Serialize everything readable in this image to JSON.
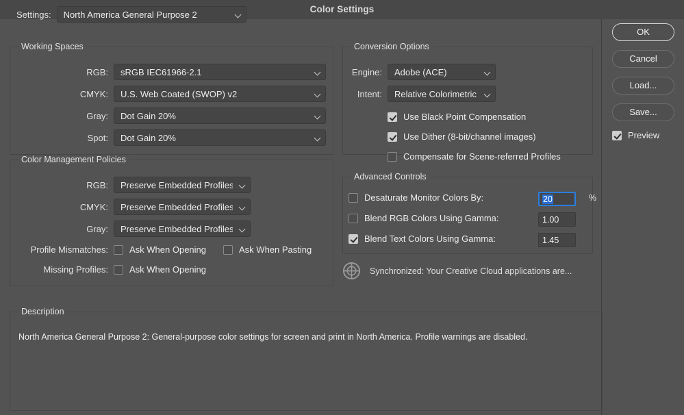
{
  "window": {
    "title": "Color Settings"
  },
  "settings": {
    "label": "Settings:",
    "value": "North America General Purpose 2"
  },
  "working_spaces": {
    "title": "Working Spaces",
    "rows": [
      {
        "label": "RGB:",
        "value": "sRGB IEC61966-2.1"
      },
      {
        "label": "CMYK:",
        "value": "U.S. Web Coated (SWOP) v2"
      },
      {
        "label": "Gray:",
        "value": "Dot Gain 20%"
      },
      {
        "label": "Spot:",
        "value": "Dot Gain 20%"
      }
    ]
  },
  "color_management_policies": {
    "title": "Color Management Policies",
    "rows": [
      {
        "label": "RGB:",
        "value": "Preserve Embedded Profiles"
      },
      {
        "label": "CMYK:",
        "value": "Preserve Embedded Profiles"
      },
      {
        "label": "Gray:",
        "value": "Preserve Embedded Profiles"
      }
    ],
    "profile_mismatches": {
      "label": "Profile Mismatches:",
      "ask_when_opening": {
        "label": "Ask When Opening",
        "checked": false
      },
      "ask_when_pasting": {
        "label": "Ask When Pasting",
        "checked": false
      }
    },
    "missing_profiles": {
      "label": "Missing Profiles:",
      "ask_when_opening": {
        "label": "Ask When Opening",
        "checked": false
      }
    }
  },
  "conversion_options": {
    "title": "Conversion Options",
    "engine": {
      "label": "Engine:",
      "value": "Adobe (ACE)"
    },
    "intent": {
      "label": "Intent:",
      "value": "Relative Colorimetric"
    },
    "checkboxes": [
      {
        "label": "Use Black Point Compensation",
        "checked": true
      },
      {
        "label": "Use Dither (8-bit/channel images)",
        "checked": true
      },
      {
        "label": "Compensate for Scene-referred Profiles",
        "checked": false
      }
    ]
  },
  "advanced_controls": {
    "title": "Advanced Controls",
    "rows": [
      {
        "label": "Desaturate Monitor Colors By:",
        "checked": false,
        "value": "20",
        "suffix": "%",
        "focused": true
      },
      {
        "label": "Blend RGB Colors Using Gamma:",
        "checked": false,
        "value": "1.00",
        "suffix": "",
        "focused": false
      },
      {
        "label": "Blend Text Colors Using Gamma:",
        "checked": true,
        "value": "1.45",
        "suffix": "",
        "focused": false
      }
    ]
  },
  "sync_status": {
    "icon": "sync-target-icon",
    "text": "Synchronized: Your Creative Cloud applications are..."
  },
  "buttons": {
    "ok": "OK",
    "cancel": "Cancel",
    "load": "Load...",
    "save": "Save...",
    "preview": {
      "label": "Preview",
      "checked": true
    }
  },
  "description": {
    "title": "Description",
    "text": "North America General Purpose 2:  General-purpose color settings for screen and print in North America. Profile warnings are disabled."
  },
  "colors": {
    "background": "#535353",
    "titlebar": "#484848",
    "control_fill": "#454545",
    "accent_focus": "#2a7fe0",
    "selection": "#2a6fd0"
  }
}
